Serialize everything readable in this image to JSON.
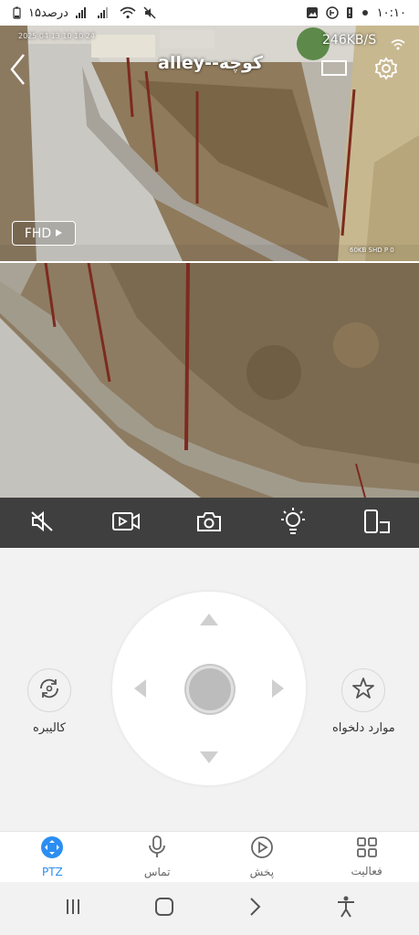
{
  "status_bar": {
    "time": "۱۰:۱۰",
    "battery_text": "۱۵درصد"
  },
  "camera": {
    "timestamp": "2025 04 13 10 10 24",
    "title": "alley--کوچه",
    "speed": "246KB/S",
    "resolution_button": "FHD",
    "stream_info": "60KB SHD P 0"
  },
  "toolbar": {
    "items": [
      "mute",
      "record",
      "snapshot",
      "light",
      "device"
    ]
  },
  "ptz": {
    "calibrate_label": "کالیبره",
    "favorites_label": "موارد دلخواه"
  },
  "bottom_nav": {
    "items": [
      {
        "label": "PTZ",
        "icon": "ptz-icon",
        "active": true
      },
      {
        "label": "تماس",
        "icon": "microphone-icon",
        "active": false
      },
      {
        "label": "پخش",
        "icon": "play-icon",
        "active": false
      },
      {
        "label": "فعالیت",
        "icon": "grid-icon",
        "active": false
      }
    ]
  },
  "colors": {
    "accent": "#2b8ef3",
    "toolbar_bg": "#3f3f3f",
    "page_bg": "#f2f2f2"
  }
}
